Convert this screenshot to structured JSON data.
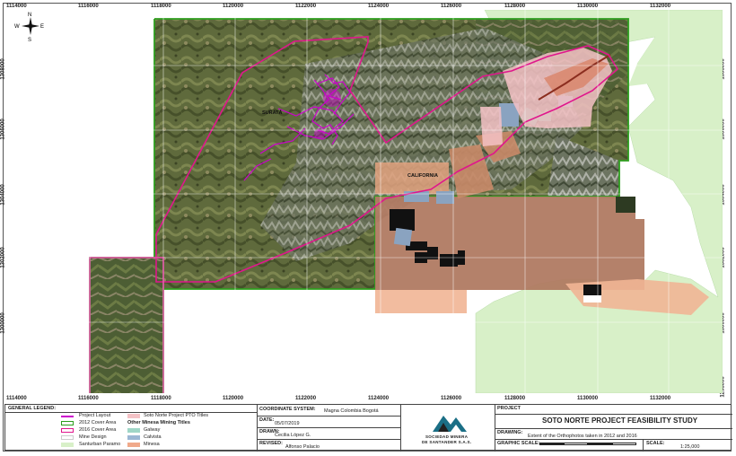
{
  "map": {
    "top_x_ticks": [
      "1114000",
      "1116000",
      "1118000",
      "1120000",
      "1122000",
      "1124000",
      "1126000",
      "1128000",
      "1130000",
      "1132000"
    ],
    "bottom_x_ticks": [
      "1114000",
      "1116000",
      "1118000",
      "1120000",
      "1122000",
      "1124000",
      "1126000",
      "1128000",
      "1130000",
      "1132000"
    ],
    "right_y_ticks": [
      "1308000",
      "1306000",
      "1304000",
      "1302000",
      "1300000",
      "1298000"
    ],
    "left_y_ticks": [
      "1308000",
      "1306000",
      "1304000",
      "1302000",
      "1300000"
    ],
    "place_labels": {
      "suratá": "SURATÁ",
      "california": "CALIFORNIA"
    },
    "compass": {
      "n": "N",
      "s": "S",
      "e": "E",
      "w": "W"
    },
    "colors": {
      "project_layout": "#cc00cc",
      "cover_2012": "#2e9e1f",
      "cover_2016": "#e0168c",
      "santurban_paramo": "#d8f0c8",
      "pto_titles": "#f4c2c6",
      "galway": "#9fd6c7",
      "calvista": "#9bb7d4",
      "minesa": "#f0a98a"
    }
  },
  "legend": {
    "title": "GENERAL LEGEND:",
    "items_left": [
      "Project Layout",
      "2012 Cover Area",
      "2016 Cover Area",
      "Mine Design",
      "Santurban Paramo"
    ],
    "items_right_header": "Soto Norte Project PTO Titles",
    "other_titles_header": "Other Minesa Mining Titles",
    "items_right": [
      "Galway",
      "Calvista",
      "Minesa"
    ]
  },
  "title_block": {
    "coordinate_label": "COORDINATE SYSTEM:",
    "coordinate_value": "Magna Colombia Bogotá",
    "date_label": "DATE:",
    "date_value": "05/07/2019",
    "drawn_label": "DRAWN:",
    "drawn_value": "Cecilia López G.",
    "revised_label": "REVISED:",
    "revised_value": "Alfonso Palacio",
    "company_line1": "SOCIEDAD MINERA",
    "company_line2": "DE SANTANDER S.A.S.",
    "project_label": "PROJECT",
    "project_title": "SOTO NORTE PROJECT FEASIBILITY STUDY",
    "drawing_label": "DRAWING:",
    "drawing_value": "Extent of the Orthophotos taken in 2012 and 2016",
    "graphic_scale_label": "GRAPHIC SCALE:",
    "scale_label": "SCALE:",
    "scale_value": "1:25,000"
  }
}
